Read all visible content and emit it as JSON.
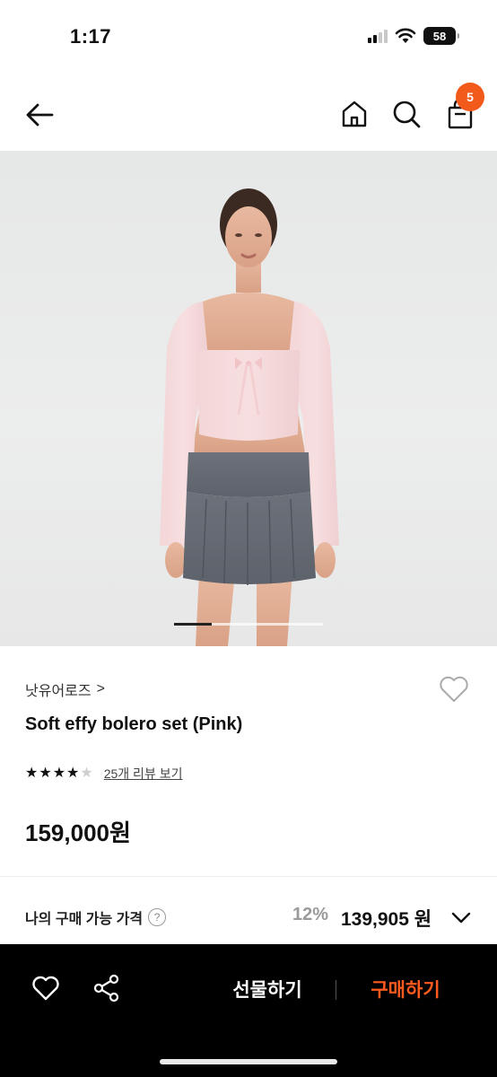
{
  "status_bar": {
    "time": "1:17",
    "battery": "58"
  },
  "nav": {
    "bag_count": "5"
  },
  "image": {
    "progress": 0.25
  },
  "product": {
    "brand": "낫유어로즈",
    "brand_chevron": ">",
    "title": "Soft effy bolero set (Pink)",
    "rating": 4,
    "rating_max": 5,
    "review_link": "25개 리뷰 보기",
    "price": "159,000원"
  },
  "my_price": {
    "label": "나의 구매 가능 가격",
    "help": "?",
    "discount": "12%",
    "final_price": "139,905 원"
  },
  "bottom_bar": {
    "gift_label": "선물하기",
    "buy_label": "구매하기"
  },
  "colors": {
    "accent": "#f25a1c",
    "buy_text": "#ff5a1f"
  }
}
